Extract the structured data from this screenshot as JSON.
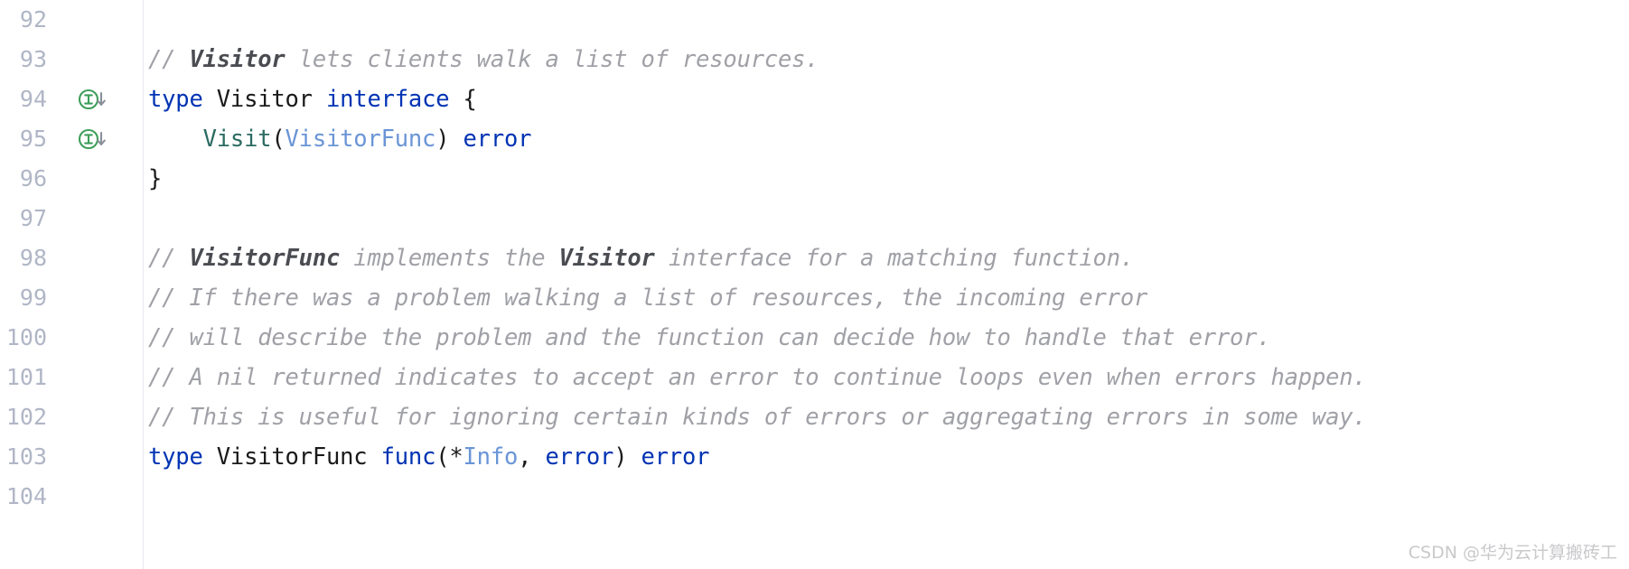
{
  "editor": {
    "language": "go",
    "gutter_separator_color": "#e8e9ee",
    "line_number_color": "#b0b6c6",
    "background_color": "#ffffff",
    "colors": {
      "keyword": "#0033b3",
      "identifier": "#1a1a1a",
      "type_reference": "#6a95d6",
      "function_declaration": "#2b6b62",
      "comment": "#a0a1a7",
      "comment_reference": "#4a4c52",
      "marker_green": "#3e9e5a"
    },
    "lines": [
      {
        "number": "92",
        "marker": null,
        "tokens": []
      },
      {
        "number": "93",
        "marker": null,
        "tokens": [
          {
            "text": "// ",
            "kind": "comment"
          },
          {
            "text": "Visitor",
            "kind": "comment-ref"
          },
          {
            "text": " lets clients walk a list of resources.",
            "kind": "comment"
          }
        ]
      },
      {
        "number": "94",
        "marker": "implemented-interface-icon",
        "marker_title": "Is implemented by",
        "tokens": [
          {
            "text": "type",
            "kind": "keyword"
          },
          {
            "text": " ",
            "kind": "plain"
          },
          {
            "text": "Visitor",
            "kind": "plain"
          },
          {
            "text": " ",
            "kind": "plain"
          },
          {
            "text": "interface",
            "kind": "keyword"
          },
          {
            "text": " ",
            "kind": "plain"
          },
          {
            "text": "{",
            "kind": "punc"
          }
        ]
      },
      {
        "number": "95",
        "marker": "implemented-interface-icon",
        "marker_title": "Is implemented by",
        "tokens": [
          {
            "text": "    ",
            "kind": "plain"
          },
          {
            "text": "Visit",
            "kind": "fn"
          },
          {
            "text": "(",
            "kind": "punc"
          },
          {
            "text": "VisitorFunc",
            "kind": "type"
          },
          {
            "text": ")",
            "kind": "punc"
          },
          {
            "text": " ",
            "kind": "plain"
          },
          {
            "text": "error",
            "kind": "keyword"
          }
        ]
      },
      {
        "number": "96",
        "marker": null,
        "tokens": [
          {
            "text": "}",
            "kind": "punc"
          }
        ]
      },
      {
        "number": "97",
        "marker": null,
        "tokens": []
      },
      {
        "number": "98",
        "marker": null,
        "tokens": [
          {
            "text": "// ",
            "kind": "comment"
          },
          {
            "text": "VisitorFunc",
            "kind": "comment-ref"
          },
          {
            "text": " implements the ",
            "kind": "comment"
          },
          {
            "text": "Visitor",
            "kind": "comment-ref"
          },
          {
            "text": " interface for a matching function.",
            "kind": "comment"
          }
        ]
      },
      {
        "number": "99",
        "marker": null,
        "tokens": [
          {
            "text": "// If there was a problem walking a list of resources, the incoming error",
            "kind": "comment"
          }
        ]
      },
      {
        "number": "100",
        "marker": null,
        "tokens": [
          {
            "text": "// will describe the problem and the function can decide how to handle that error.",
            "kind": "comment"
          }
        ]
      },
      {
        "number": "101",
        "marker": null,
        "tokens": [
          {
            "text": "// A nil returned indicates to accept an error to continue loops even when errors happen.",
            "kind": "comment"
          }
        ]
      },
      {
        "number": "102",
        "marker": null,
        "tokens": [
          {
            "text": "// This is useful for ignoring certain kinds of errors or aggregating errors in some way.",
            "kind": "comment"
          }
        ]
      },
      {
        "number": "103",
        "marker": null,
        "tokens": [
          {
            "text": "type",
            "kind": "keyword"
          },
          {
            "text": " ",
            "kind": "plain"
          },
          {
            "text": "VisitorFunc",
            "kind": "plain"
          },
          {
            "text": " ",
            "kind": "plain"
          },
          {
            "text": "func",
            "kind": "keyword"
          },
          {
            "text": "(",
            "kind": "punc"
          },
          {
            "text": "*",
            "kind": "punc"
          },
          {
            "text": "Info",
            "kind": "type"
          },
          {
            "text": ", ",
            "kind": "punc"
          },
          {
            "text": "error",
            "kind": "keyword"
          },
          {
            "text": ")",
            "kind": "punc"
          },
          {
            "text": " ",
            "kind": "plain"
          },
          {
            "text": "error",
            "kind": "keyword"
          }
        ]
      },
      {
        "number": "104",
        "marker": null,
        "tokens": []
      }
    ]
  },
  "watermark": {
    "text": "CSDN @华为云计算搬砖工"
  }
}
